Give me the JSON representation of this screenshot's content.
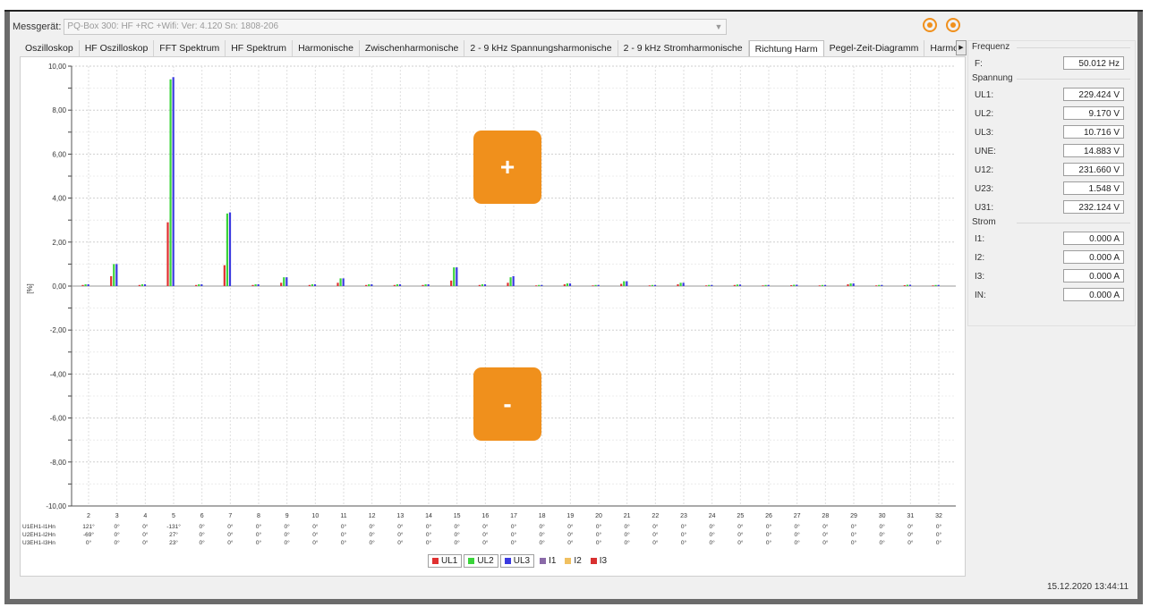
{
  "device": {
    "label": "Messgerät:",
    "value": "PQ-Box 300: HF +RC +Wifi: Ver: 4.120 Sn: 1808-206"
  },
  "tabs": [
    "Oszilloskop",
    "HF Oszilloskop",
    "FFT Spektrum",
    "HF Spektrum",
    "Harmonische",
    "Zwischenharmonische",
    "2 - 9 kHz Spannungsharmonische",
    "2 - 9 kHz Stromharmonische",
    "Richtung Harm",
    "Pegel-Zeit-Diagramm",
    "Harmonisch"
  ],
  "active_tab": "Richtung Harm",
  "buttons": {
    "plus": "+",
    "minus": "-"
  },
  "sidebar": {
    "frequenz": {
      "title": "Frequenz",
      "rows": [
        {
          "label": "F:",
          "value": "50.012 Hz"
        }
      ]
    },
    "spannung": {
      "title": "Spannung",
      "rows": [
        {
          "label": "UL1:",
          "value": "229.424 V"
        },
        {
          "label": "UL2:",
          "value": "9.170 V"
        },
        {
          "label": "UL3:",
          "value": "10.716 V"
        },
        {
          "label": "UNE:",
          "value": "14.883 V"
        },
        {
          "label": "U12:",
          "value": "231.660 V"
        },
        {
          "label": "U23:",
          "value": "1.548 V"
        },
        {
          "label": "U31:",
          "value": "232.124 V"
        }
      ]
    },
    "strom": {
      "title": "Strom",
      "rows": [
        {
          "label": "I1:",
          "value": "0.000 A"
        },
        {
          "label": "I2:",
          "value": "0.000 A"
        },
        {
          "label": "I3:",
          "value": "0.000 A"
        },
        {
          "label": "IN:",
          "value": "0.000 A"
        }
      ]
    }
  },
  "datetime": "15.12.2020 13:44:11",
  "colors": {
    "accent": "#f0901c",
    "UL1": "#e03030",
    "UL2": "#3ad43a",
    "UL3": "#3a3ae0",
    "I1": "#8a6aa8",
    "I2": "#f0c060",
    "I3": "#d83030"
  },
  "chart_data": {
    "type": "bar",
    "ylabel": "[%]",
    "ylim": [
      -10,
      10
    ],
    "yticks": [
      "10,00",
      "8,00",
      "6,00",
      "4,00",
      "2,00",
      "0,00",
      "-2,00",
      "-4,00",
      "-6,00",
      "-8,00",
      "-10,00"
    ],
    "categories": [
      "2",
      "3",
      "4",
      "5",
      "6",
      "7",
      "8",
      "9",
      "10",
      "11",
      "12",
      "13",
      "14",
      "15",
      "16",
      "17",
      "18",
      "19",
      "20",
      "21",
      "22",
      "23",
      "24",
      "25",
      "26",
      "27",
      "28",
      "29",
      "30",
      "31",
      "32"
    ],
    "series": [
      {
        "name": "UL1",
        "values": [
          0.05,
          0.45,
          0.05,
          2.9,
          0.05,
          0.95,
          0.05,
          0.15,
          0.05,
          0.15,
          0.05,
          0.05,
          0.05,
          0.25,
          0.05,
          0.15,
          0.03,
          0.08,
          0.03,
          0.1,
          0.03,
          0.08,
          0.03,
          0.05,
          0.03,
          0.04,
          0.03,
          0.08,
          0.03,
          0.04,
          0.03
        ]
      },
      {
        "name": "UL2",
        "values": [
          0.08,
          1.0,
          0.08,
          9.4,
          0.08,
          3.3,
          0.08,
          0.4,
          0.08,
          0.35,
          0.08,
          0.08,
          0.08,
          0.85,
          0.08,
          0.4,
          0.05,
          0.12,
          0.05,
          0.22,
          0.05,
          0.15,
          0.05,
          0.07,
          0.05,
          0.06,
          0.05,
          0.12,
          0.05,
          0.06,
          0.05
        ]
      },
      {
        "name": "UL3",
        "values": [
          0.08,
          1.0,
          0.08,
          9.5,
          0.08,
          3.35,
          0.08,
          0.4,
          0.08,
          0.35,
          0.08,
          0.08,
          0.08,
          0.85,
          0.08,
          0.45,
          0.05,
          0.12,
          0.05,
          0.22,
          0.05,
          0.15,
          0.05,
          0.07,
          0.05,
          0.06,
          0.05,
          0.12,
          0.05,
          0.06,
          0.05
        ]
      },
      {
        "name": "I1",
        "values": [
          0,
          0,
          0,
          0,
          0,
          0,
          0,
          0,
          0,
          0,
          0,
          0,
          0,
          0,
          0,
          0,
          0,
          0,
          0,
          0,
          0,
          0,
          0,
          0,
          0,
          0,
          0,
          0,
          0,
          0,
          0
        ]
      },
      {
        "name": "I2",
        "values": [
          0,
          0,
          0,
          0,
          0,
          0,
          0,
          0,
          0,
          0,
          0,
          0,
          0,
          0,
          0,
          0,
          0,
          0,
          0,
          0,
          0,
          0,
          0,
          0,
          0,
          0,
          0,
          0,
          0,
          0,
          0
        ]
      },
      {
        "name": "I3",
        "values": [
          0,
          0,
          0,
          0,
          0,
          0,
          0,
          0,
          0,
          0,
          0,
          0,
          0,
          0,
          0,
          0,
          0,
          0,
          0,
          0,
          0,
          0,
          0,
          0,
          0,
          0,
          0,
          0,
          0,
          0,
          0
        ]
      }
    ],
    "phase_rows": [
      {
        "label": "U1EH1-I1Hn",
        "values": [
          "121°",
          "0°",
          "0°",
          "-131°",
          "0°",
          "0°",
          "0°",
          "0°",
          "0°",
          "0°",
          "0°",
          "0°",
          "0°",
          "0°",
          "0°",
          "0°",
          "0°",
          "0°",
          "0°",
          "0°",
          "0°",
          "0°",
          "0°",
          "0°",
          "0°",
          "0°",
          "0°",
          "0°",
          "0°",
          "0°",
          "0°"
        ]
      },
      {
        "label": "U2EH1-I2Hn",
        "values": [
          "-69°",
          "0°",
          "0°",
          "27°",
          "0°",
          "0°",
          "0°",
          "0°",
          "0°",
          "0°",
          "0°",
          "0°",
          "0°",
          "0°",
          "0°",
          "0°",
          "0°",
          "0°",
          "0°",
          "0°",
          "0°",
          "0°",
          "0°",
          "0°",
          "0°",
          "0°",
          "0°",
          "0°",
          "0°",
          "0°",
          "0°"
        ]
      },
      {
        "label": "U3EH1-I3Hn",
        "values": [
          "0°",
          "0°",
          "0°",
          "23°",
          "0°",
          "0°",
          "0°",
          "0°",
          "0°",
          "0°",
          "0°",
          "0°",
          "0°",
          "0°",
          "0°",
          "0°",
          "0°",
          "0°",
          "0°",
          "0°",
          "0°",
          "0°",
          "0°",
          "0°",
          "0°",
          "0°",
          "0°",
          "0°",
          "0°",
          "0°",
          "0°"
        ]
      }
    ],
    "legend": [
      "UL1",
      "UL2",
      "UL3",
      "I1",
      "I2",
      "I3"
    ],
    "grid": true
  }
}
